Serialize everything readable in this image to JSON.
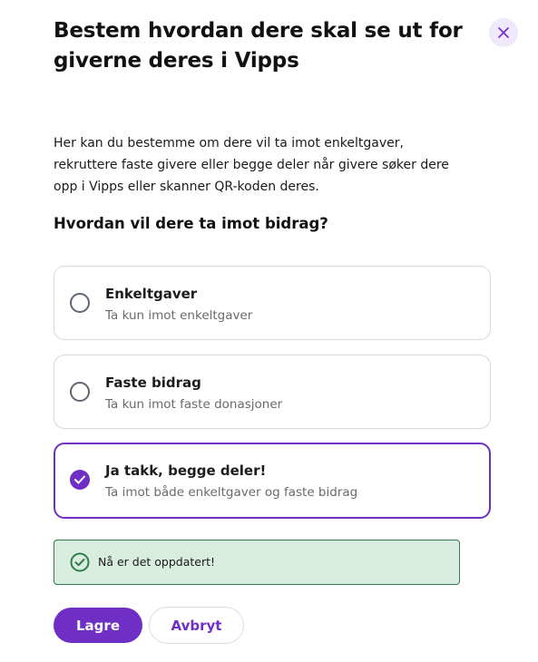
{
  "dialog": {
    "title": "Bestem hvordan dere skal se ut for giverne deres i Vipps",
    "intro": "Her kan du bestemme om dere vil ta imot enkeltgaver, rekruttere faste givere eller begge deler når givere søker dere opp i Vipps eller skanner QR-koden deres.",
    "question": "Hvordan vil dere ta imot bidrag?"
  },
  "options": [
    {
      "title": "Enkeltgaver",
      "subtitle": "Ta kun imot enkeltgaver",
      "selected": false
    },
    {
      "title": "Faste bidrag",
      "subtitle": "Ta kun imot faste donasjoner",
      "selected": false
    },
    {
      "title": "Ja takk, begge deler!",
      "subtitle": "Ta imot både enkeltgaver og faste bidrag",
      "selected": true
    }
  ],
  "alert": {
    "text": "Nå er det oppdatert!",
    "icon": "check-circle-icon"
  },
  "actions": {
    "save_label": "Lagre",
    "cancel_label": "Avbryt"
  },
  "colors": {
    "accent": "#6f2fc4",
    "success_bg": "#d8ecdf",
    "success_border": "#2f7d4e",
    "close_bg": "#efe9fb"
  },
  "icons": {
    "close": "close-icon",
    "radio_checked": "checkmark-icon"
  }
}
